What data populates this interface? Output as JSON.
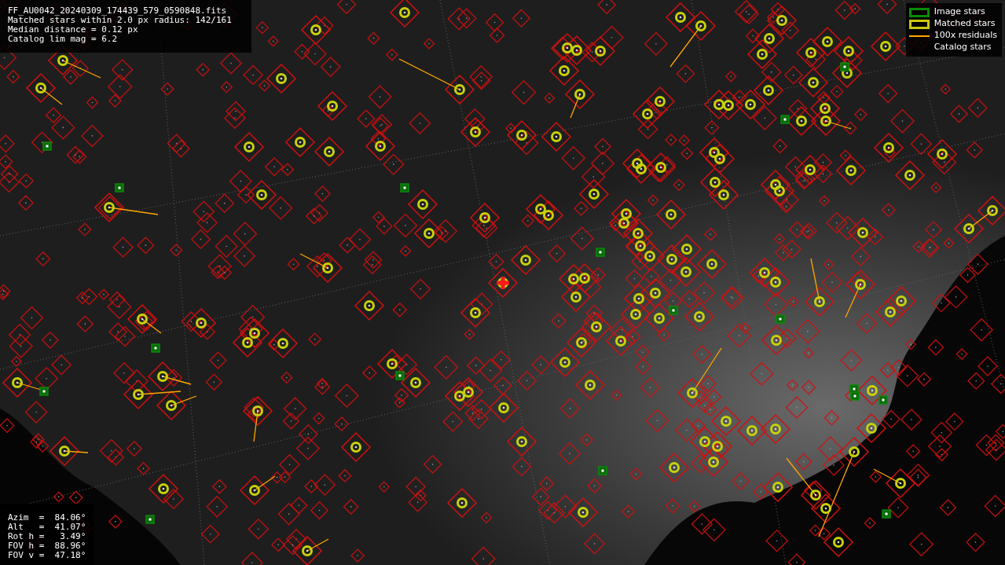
{
  "header_lines": [
    "FF_AU0042_20240309_174439_579_0590848.fits",
    "Matched stars within 2.0 px radius: 142/161",
    "Median distance = 0.12 px",
    "Catalog lim mag = 6.2"
  ],
  "legend": [
    {
      "kind": "image",
      "label": "Image stars",
      "color": "#0a8a0a"
    },
    {
      "kind": "matched",
      "label": "Matched stars",
      "color": "#c8c80a"
    },
    {
      "kind": "residual",
      "label": "100x residuals",
      "color": "#ffa500"
    },
    {
      "kind": "catalog",
      "label": "Catalog stars"
    }
  ],
  "pointing_lines": [
    "Azim  =  84.06°",
    "Alt   =  41.07°",
    "Rot h =   3.49°",
    "FOV h =  88.96°",
    "FOV v =  47.18°"
  ]
}
